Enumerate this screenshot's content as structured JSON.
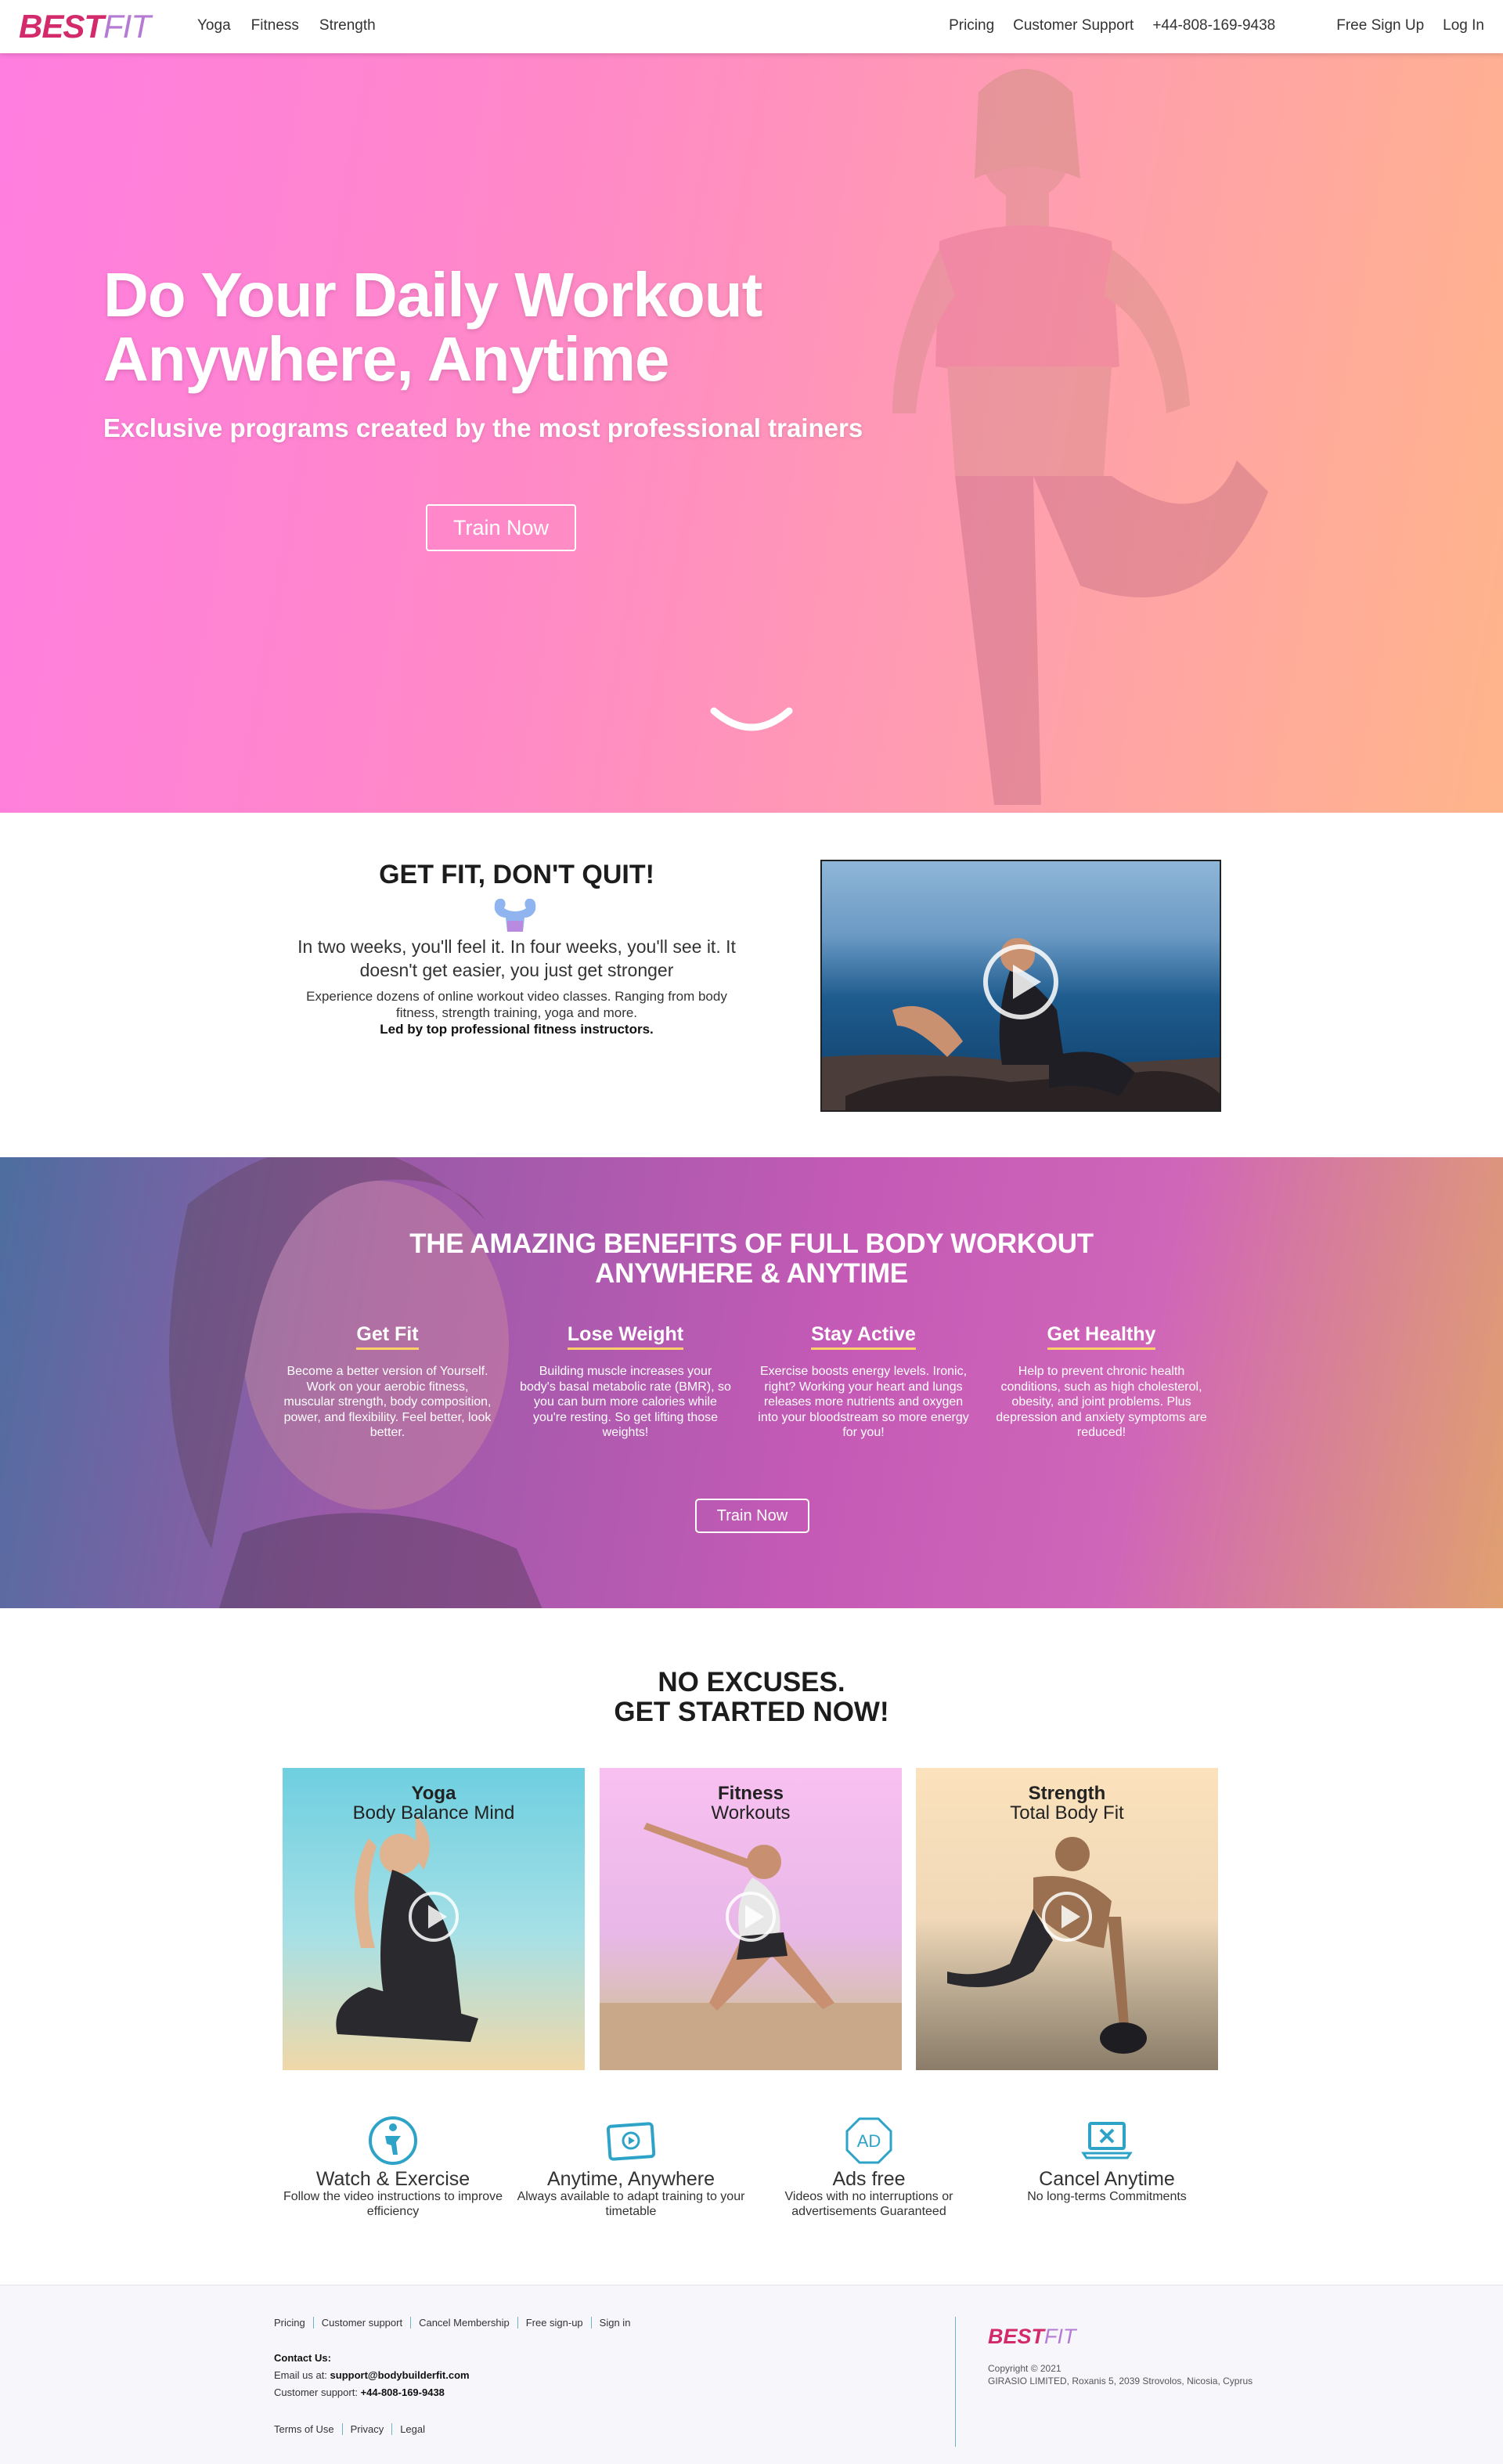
{
  "brand": {
    "part1": "BEST",
    "part2": "FIT"
  },
  "nav": {
    "left": [
      "Yoga",
      "Fitness",
      "Strength"
    ],
    "right": [
      "Pricing",
      "Customer Support",
      "+44-808-169-9438",
      "Free Sign Up",
      "Log In"
    ]
  },
  "hero": {
    "title_line1": "Do Your Daily Workout",
    "title_line2": "Anywhere, Anytime",
    "subtitle": "Exclusive programs created by the most professional trainers",
    "cta": "Train Now"
  },
  "intro": {
    "heading": "GET FIT, DON'T QUIT!",
    "lead": "In two weeks, you'll feel it. In four weeks, you'll see it. It doesn't get easier, you just get stronger",
    "body": "Experience dozens of online workout video classes. Ranging from body fitness, strength training, yoga and more.",
    "bold": "Led by top professional fitness instructors."
  },
  "benefits": {
    "heading_line1": "THE AMAZING BENEFITS OF FULL BODY WORKOUT",
    "heading_line2": "ANYWHERE & ANYTIME",
    "items": [
      {
        "title": "Get Fit",
        "text": "Become a better version of Yourself. Work on your aerobic fitness, muscular strength, body composition, power, and flexibility. Feel better, look better."
      },
      {
        "title": "Lose Weight",
        "text": "Building muscle increases your body's basal metabolic rate (BMR), so you can burn more calories while you're resting. So get lifting those weights!"
      },
      {
        "title": "Stay Active",
        "text": "Exercise boosts energy levels. Ironic, right? Working your heart and lungs releases more nutrients and oxygen into your bloodstream so more energy for you!"
      },
      {
        "title": "Get Healthy",
        "text": "Help to prevent chronic health conditions, such as high cholesterol, obesity, and joint problems. Plus depression and anxiety symptoms are reduced!"
      }
    ],
    "cta": "Train Now"
  },
  "programs": {
    "heading_line1": "NO EXCUSES.",
    "heading_line2": "GET STARTED NOW!",
    "cards": [
      {
        "title": "Yoga",
        "subtitle": "Body Balance Mind"
      },
      {
        "title": "Fitness",
        "subtitle": "Workouts"
      },
      {
        "title": "Strength",
        "subtitle": "Total Body Fit"
      }
    ]
  },
  "features": [
    {
      "icon": "exercise-icon",
      "title": "Watch & Exercise",
      "text": "Follow the video instructions to improve efficiency"
    },
    {
      "icon": "video-icon",
      "title": "Anytime, Anywhere",
      "text": "Always available to adapt training to your timetable"
    },
    {
      "icon": "ad-icon",
      "title": "Ads free",
      "text": "Videos with no interruptions or advertisements Guaranteed"
    },
    {
      "icon": "laptop-cancel-icon",
      "title": "Cancel Anytime",
      "text": "No long-terms Commitments"
    }
  ],
  "footer": {
    "links": [
      "Pricing",
      "Customer support",
      "Cancel Membership",
      "Free sign-up",
      "Sign in"
    ],
    "contact_label": "Contact Us:",
    "email_label": "Email us at:",
    "email": "support@bodybuilderfit.com",
    "phone_label": "Customer support:",
    "phone": "+44-808-169-9438",
    "legal": [
      "Terms of Use",
      "Privacy",
      "Legal"
    ],
    "copyright": "Copyright © 2021",
    "company": "GIRASIO LIMITED, Roxanis 5, 2039 Strovolos, Nicosia, Cyprus"
  },
  "colors": {
    "brand_red": "#d32a6b",
    "brand_purple": "#b57ad3",
    "accent_blue": "#2ea3c8"
  }
}
